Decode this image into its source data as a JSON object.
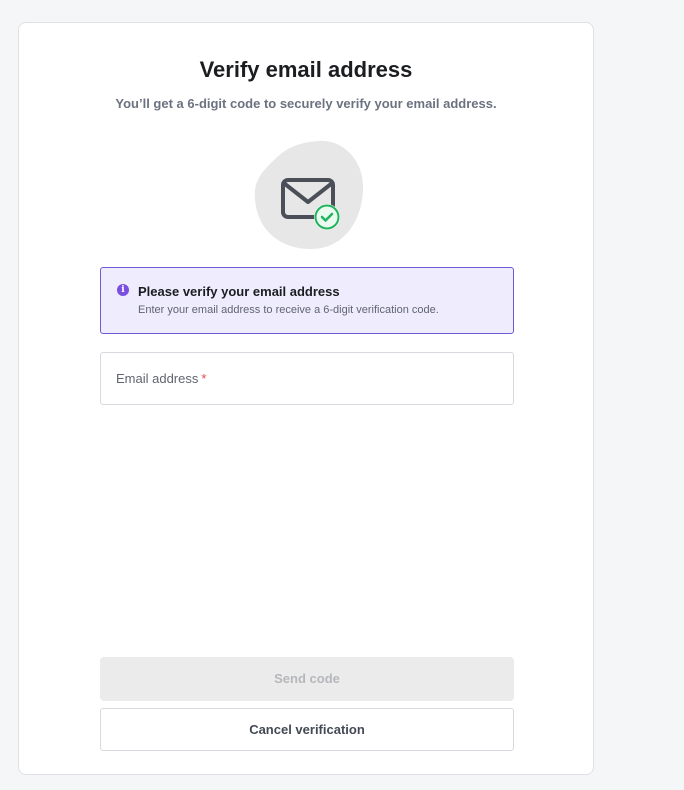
{
  "page": {
    "title": "Verify email address",
    "subtitle": "You’ll get a 6-digit code to securely verify your email address."
  },
  "illustration": {
    "icon": "envelope-check-icon",
    "colors": {
      "blob": "#e7e7e7",
      "envelope": "#4b4f58",
      "check": "#22b35e"
    }
  },
  "notice": {
    "icon": "info-icon",
    "title": "Please verify your email address",
    "description": "Enter your email address to receive a 6-digit verification code.",
    "colors": {
      "background": "#efecfd",
      "border": "#6c5bd4",
      "icon": "#7b4fe0"
    }
  },
  "email_field": {
    "label": "Email address",
    "required_mark": "*",
    "value": ""
  },
  "actions": {
    "send_label": "Send code",
    "send_disabled": true,
    "cancel_label": "Cancel verification"
  }
}
